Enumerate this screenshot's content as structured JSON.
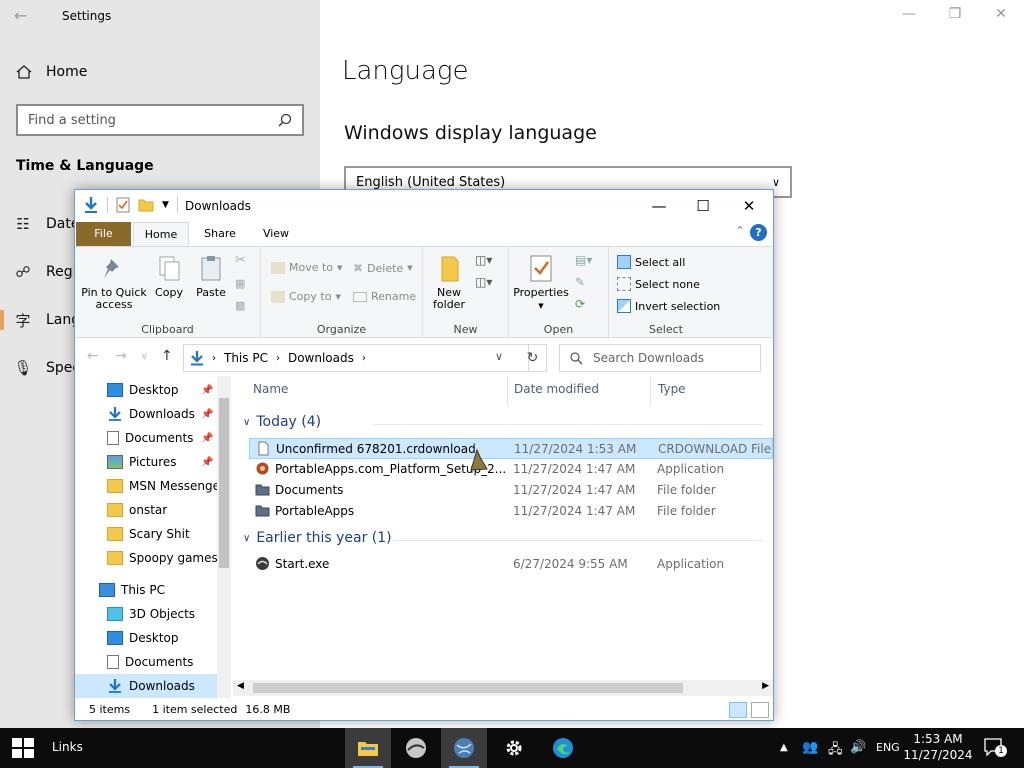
{
  "settings": {
    "window_title": "Settings",
    "home_label": "Home",
    "search_placeholder": "Find a setting",
    "category": "Time & Language",
    "nav_items": [
      "Date",
      "Regi",
      "Lang",
      "Spee"
    ],
    "page_title": "Language",
    "section_title": "Windows display language",
    "display_language": "English (United States)"
  },
  "explorer": {
    "title": "Downloads",
    "tabs": {
      "file": "File",
      "home": "Home",
      "share": "Share",
      "view": "View"
    },
    "ribbon": {
      "clipboard": {
        "label": "Clipboard",
        "pin": "Pin to Quick access",
        "pin_l1": "Pin to Quick",
        "pin_l2": "access",
        "copy": "Copy",
        "paste": "Paste"
      },
      "organize": {
        "label": "Organize",
        "move_to": "Move to",
        "copy_to": "Copy to",
        "delete": "Delete",
        "rename": "Rename"
      },
      "new": {
        "label": "New",
        "new_folder_l1": "New",
        "new_folder_l2": "folder"
      },
      "open": {
        "label": "Open",
        "properties": "Properties"
      },
      "select": {
        "label": "Select",
        "select_all": "Select all",
        "select_none": "Select none",
        "invert": "Invert selection"
      }
    },
    "address": {
      "crumb1": "This PC",
      "crumb2": "Downloads"
    },
    "search_placeholder": "Search Downloads",
    "nav_pane": [
      {
        "label": "Desktop",
        "pinned": true
      },
      {
        "label": "Downloads",
        "pinned": true
      },
      {
        "label": "Documents",
        "pinned": true
      },
      {
        "label": "Pictures",
        "pinned": true
      },
      {
        "label": "MSN Messenger",
        "pinned": false
      },
      {
        "label": "onstar",
        "pinned": false
      },
      {
        "label": "Scary Shit",
        "pinned": false
      },
      {
        "label": "Spoopy games",
        "pinned": false
      },
      {
        "label": "This PC",
        "pinned": false
      },
      {
        "label": "3D Objects",
        "pinned": false
      },
      {
        "label": "Desktop",
        "pinned": false
      },
      {
        "label": "Documents",
        "pinned": false
      },
      {
        "label": "Downloads",
        "pinned": false
      }
    ],
    "columns": {
      "name": "Name",
      "date": "Date modified",
      "type": "Type"
    },
    "groups": {
      "today": "Today (4)",
      "earlier": "Earlier this year (1)"
    },
    "files_today": [
      {
        "name": "Unconfirmed 678201.crdownload",
        "date": "11/27/2024 1:53 AM",
        "type": "CRDOWNLOAD File",
        "icon": "blank-file-icon"
      },
      {
        "name": "PortableApps.com_Platform_Setup_2...",
        "date": "11/27/2024 1:47 AM",
        "type": "Application",
        "icon": "installer-icon"
      },
      {
        "name": "Documents",
        "date": "11/27/2024 1:47 AM",
        "type": "File folder",
        "icon": "folder-icon"
      },
      {
        "name": "PortableApps",
        "date": "11/27/2024 1:47 AM",
        "type": "File folder",
        "icon": "folder-icon"
      }
    ],
    "files_earlier": [
      {
        "name": "Start.exe",
        "date": "6/27/2024 9:55 AM",
        "type": "Application",
        "icon": "app-icon"
      }
    ],
    "status": {
      "count": "5 items",
      "selected": "1 item selected",
      "size": "16.8 MB"
    }
  },
  "taskbar": {
    "links": "Links",
    "lang": "ENG",
    "time": "1:53 AM",
    "date": "11/27/2024",
    "notif_count": "1"
  },
  "colors": {
    "accent": "#0078d7",
    "file_tab": "#8a6a2a",
    "selection": "#cce8ff",
    "folder": "#f4c84a"
  }
}
